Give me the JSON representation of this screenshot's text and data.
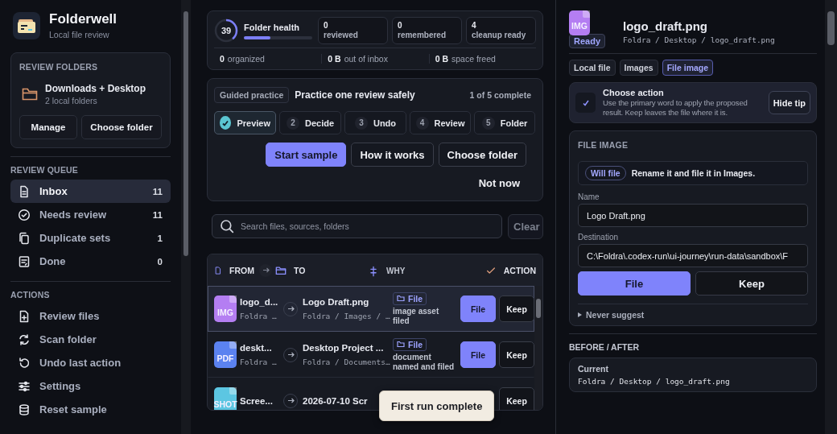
{
  "sidebar": {
    "app_title": "Folderwell",
    "app_subtitle": "Local file review",
    "folders_card": {
      "heading": "REVIEW FOLDERS",
      "name": "Downloads + Desktop",
      "detail": "2 local folders",
      "buttons": [
        "Manage",
        "Choose folder"
      ]
    },
    "queue": {
      "heading": "REVIEW QUEUE",
      "items": [
        {
          "kind": "inbox",
          "label": "Inbox",
          "count": "11",
          "selected": true
        },
        {
          "kind": "needs",
          "label": "Needs review",
          "count": "11",
          "selected": false
        },
        {
          "kind": "duplicates",
          "label": "Duplicate sets",
          "count": "1",
          "selected": false
        },
        {
          "kind": "done",
          "label": "Done",
          "count": "0",
          "selected": false
        }
      ]
    },
    "actions": {
      "heading": "ACTIONS",
      "items": [
        {
          "kind": "review",
          "label": "Review files"
        },
        {
          "kind": "scan",
          "label": "Scan folder"
        },
        {
          "kind": "undo",
          "label": "Undo last action"
        },
        {
          "kind": "settings",
          "label": "Settings"
        },
        {
          "kind": "reset",
          "label": "Reset sample"
        }
      ]
    }
  },
  "main": {
    "health": {
      "score": "39",
      "label": "Folder health",
      "level": 0.39
    },
    "stats": [
      {
        "value": "0",
        "label": "reviewed"
      },
      {
        "value": "0",
        "label": "remembered"
      },
      {
        "value": "4",
        "label": "cleanup ready"
      }
    ],
    "totals": [
      {
        "value": "0",
        "label": "organized"
      },
      {
        "value": "0 B",
        "label": "out of inbox"
      },
      {
        "value": "0 B",
        "label": "space freed"
      }
    ],
    "practice": {
      "chip": "Guided practice",
      "title": "Practice one review safely",
      "progress": "1 of 5 complete",
      "steps": [
        {
          "label": "Preview",
          "done": true,
          "selected": true
        },
        {
          "number": "2",
          "label": "Decide",
          "done": false,
          "selected": false
        },
        {
          "number": "3",
          "label": "Undo",
          "done": false,
          "selected": false
        },
        {
          "number": "4",
          "label": "Review",
          "done": false,
          "selected": false
        },
        {
          "number": "5",
          "label": "Folder",
          "done": false,
          "selected": false
        }
      ],
      "buttons": [
        {
          "label": "Start sample",
          "primary": true
        },
        {
          "label": "How it works",
          "primary": false
        },
        {
          "label": "Choose folder",
          "primary": false
        }
      ],
      "dismiss": "Not now"
    },
    "search": {
      "placeholder": "Search files, sources, folders",
      "clear": "Clear"
    },
    "table": {
      "columns": [
        {
          "kind": "from",
          "label": "FROM"
        },
        {
          "kind": "to",
          "label": "TO"
        },
        {
          "kind": "why",
          "label": "WHY"
        },
        {
          "kind": "action",
          "label": "ACTION"
        }
      ],
      "rows": [
        {
          "type_label": "IMG",
          "color": "#b47ef2",
          "from_name": "logo_d...",
          "from_path": "Foldra …",
          "to_name": "Logo Draft.png",
          "to_path": "Foldra / Images / …",
          "tag": "File",
          "why": "image asset filed",
          "primary": "File",
          "secondary": "Keep",
          "selected": true
        },
        {
          "type_label": "PDF",
          "color": "#5b82f0",
          "from_name": "deskt...",
          "from_path": "Foldra …",
          "to_name": "Desktop Project ...",
          "to_path": "Foldra / Documents…",
          "tag": "File",
          "why": "document named and filed",
          "primary": "File",
          "secondary": "Keep",
          "selected": false
        },
        {
          "type_label": "SHOT",
          "color": "#5cc6e2",
          "from_name": "Scree...",
          "to_name": "2026-07-10 Scr",
          "secondary": "Keep",
          "selected": false
        }
      ]
    },
    "toast": "First run complete"
  },
  "detail": {
    "file_type": "IMG",
    "status": "Ready",
    "name": "logo_draft.png",
    "path": "Foldra / Desktop / logo_draft.png",
    "chips": [
      {
        "label": "Local file",
        "selected": false
      },
      {
        "label": "Images",
        "selected": false
      },
      {
        "label": "File image",
        "selected": true
      }
    ],
    "tip": {
      "title": "Choose action",
      "text": "Use the primary word to apply the proposed result. Keep leaves the file where it is.",
      "button": "Hide tip",
      "checked": true
    },
    "form": {
      "heading": "FILE IMAGE",
      "pill": "Will file",
      "summary": "Rename it and file it in Images.",
      "fields": [
        {
          "label": "Name",
          "value": "Logo Draft.png"
        },
        {
          "label": "Destination",
          "value": "C:\\Foldra\\.codex-run\\ui-journey\\run-data\\sandbox\\F"
        }
      ],
      "buttons": [
        {
          "label": "File",
          "primary": true
        },
        {
          "label": "Keep",
          "primary": false
        }
      ],
      "disclosure": {
        "label": "Never suggest",
        "expanded": false
      }
    },
    "before_after": {
      "heading": "BEFORE / AFTER",
      "label": "Current",
      "path": "Foldra / Desktop / logo_draft.png"
    }
  }
}
